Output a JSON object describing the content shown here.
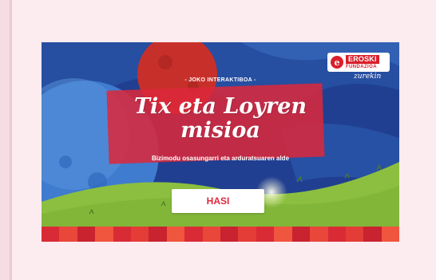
{
  "game": {
    "kicker": "- JOKO INTERAKTIBOA -",
    "title_line1": "Tix eta Loyren",
    "title_line2": "misioa",
    "subtitle": "Bizimodu osasungarri eta arduratsuaren alde",
    "start_label": "HASI"
  },
  "brand": {
    "mark": "e",
    "name": "EROSKI",
    "sub": "FUNDAZIOA",
    "tagline": "zurekin"
  },
  "colors": {
    "accent_red": "#e2263a",
    "night_blue": "#1f3e8e",
    "grass_green": "#8cbf3f",
    "page_background": "#fcebef"
  }
}
